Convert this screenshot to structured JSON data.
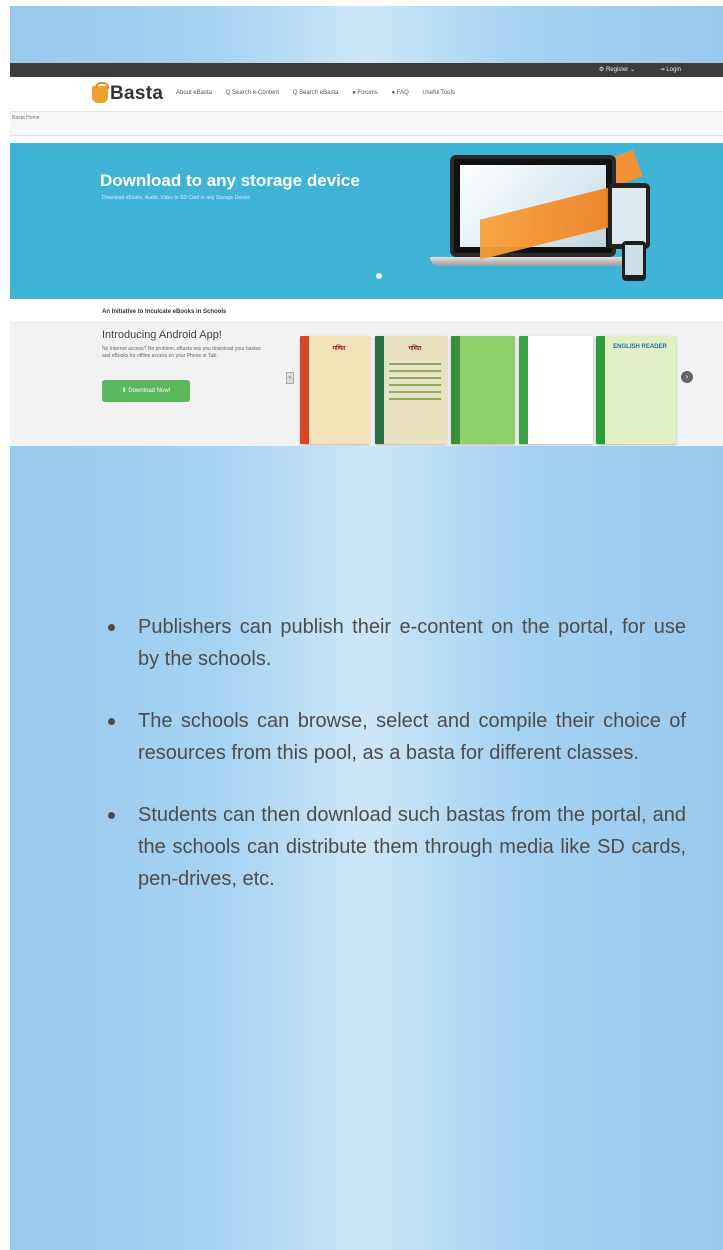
{
  "site": {
    "topbar": {
      "register": "⚙ Register ⌄",
      "login": "⇥ Login"
    },
    "logo": "Basta",
    "nav": [
      "About eBasta",
      "Q Search e-Content",
      "Q Search eBasta",
      "● Forums",
      "● FAQ",
      "Useful Tools"
    ],
    "breadcrumb": "Basta Home",
    "banner": {
      "title": "Download to any storage device",
      "subtitle": "Download eBooks, Audio, Video to SD Card or any Storage Device"
    },
    "initiative": "An Initiative to Inculcate eBooks in Schools",
    "android": {
      "title": "Introducing Android App!",
      "description": "No Internet access? No problem, eBasta lets you download your bastas and eBooks for offline access on your Phone or Tab.",
      "button": "⬇ Download Now!"
    },
    "carousel": {
      "prev": "<",
      "next": "›"
    },
    "books": [
      {
        "title": "गणित",
        "bg": "#f4e2b8",
        "spine": "#d9452b"
      },
      {
        "title": "गणित",
        "bg": "#e9e2c1",
        "spine": "#2b6e4a"
      },
      {
        "title": "",
        "bg": "#8fd06a",
        "spine": "#3a8f3a"
      },
      {
        "title": "",
        "bg": "#ffffff",
        "spine": "#3aa04a"
      },
      {
        "title": "ENGLISH READER",
        "bg": "#dff0c5",
        "spine": "#2a9a3a"
      }
    ]
  },
  "bullets": [
    "Publishers can publish their e-content on the portal, for use by the schools.",
    "The schools can browse, select and compile their choice of resources from this pool, as a basta for different classes.",
    "Students can then download such bastas from the portal, and the schools can distribute them through media like SD cards, pen-drives, etc."
  ]
}
